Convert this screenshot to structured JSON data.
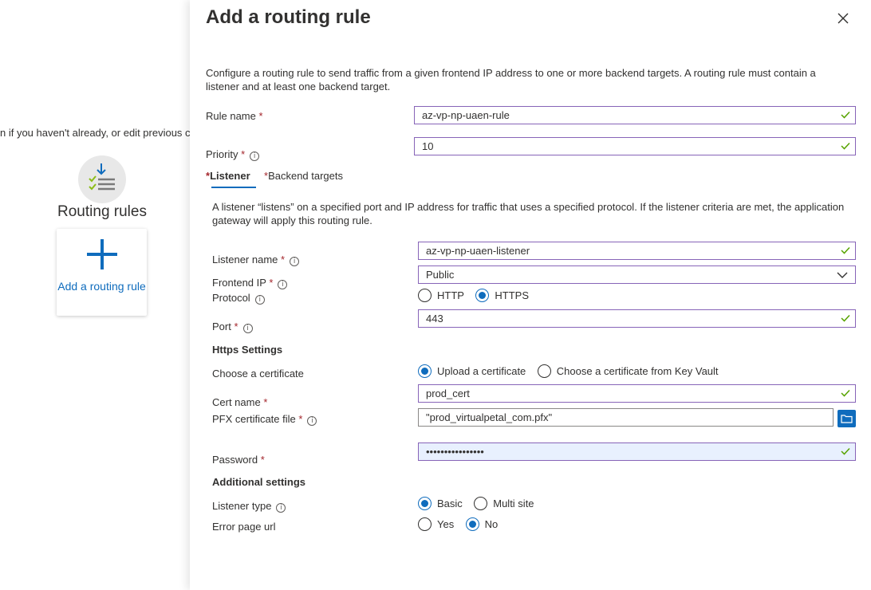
{
  "background": {
    "hint_text": "n if you haven't already, or edit previous c",
    "routing_rules_title": "Routing rules",
    "add_card_label": "Add a routing rule"
  },
  "panel": {
    "title": "Add a routing rule",
    "description": "Configure a routing rule to send traffic from a given frontend IP address to one or more backend targets. A routing rule must contain a listener and at least one backend target.",
    "rule_name": {
      "label": "Rule name",
      "value": "az-vp-np-uaen-rule"
    },
    "priority": {
      "label": "Priority",
      "value": "10"
    },
    "tabs": [
      {
        "label": "Listener",
        "active": true
      },
      {
        "label": "Backend targets",
        "active": false
      }
    ],
    "listener": {
      "description": "A listener “listens” on a specified port and IP address for traffic that uses a specified protocol. If the listener criteria are met, the application gateway will apply this routing rule.",
      "listener_name": {
        "label": "Listener name",
        "value": "az-vp-np-uaen-listener"
      },
      "frontend_ip": {
        "label": "Frontend IP",
        "value": "Public"
      },
      "protocol": {
        "label": "Protocol",
        "options": [
          "HTTP",
          "HTTPS"
        ],
        "selected": "HTTPS"
      },
      "port": {
        "label": "Port",
        "value": "443"
      },
      "https_settings_heading": "Https Settings",
      "choose_certificate": {
        "label": "Choose a certificate",
        "options": [
          "Upload a certificate",
          "Choose a certificate from Key Vault"
        ],
        "selected": "Upload a certificate"
      },
      "cert_name": {
        "label": "Cert name",
        "value": "prod_cert"
      },
      "pfx_file": {
        "label": "PFX certificate file",
        "value": "\"prod_virtualpetal_com.pfx\""
      },
      "password": {
        "label": "Password",
        "value": "••••••••••••••••"
      },
      "additional_settings_heading": "Additional settings",
      "listener_type": {
        "label": "Listener type",
        "options": [
          "Basic",
          "Multi site"
        ],
        "selected": "Basic"
      },
      "error_page_url": {
        "label": "Error page url",
        "options": [
          "Yes",
          "No"
        ],
        "selected": "No"
      }
    }
  },
  "icons": {
    "close": "close-icon",
    "check": "check-icon",
    "chevron": "chevron-down-icon",
    "info": "info-icon",
    "folder": "folder-icon",
    "add": "plus-icon",
    "routing": "routing-rules-icon"
  },
  "colors": {
    "accent": "#0f6cbd",
    "valid_border": "#8764b8",
    "check": "#57a300",
    "required": "#a4262c"
  }
}
